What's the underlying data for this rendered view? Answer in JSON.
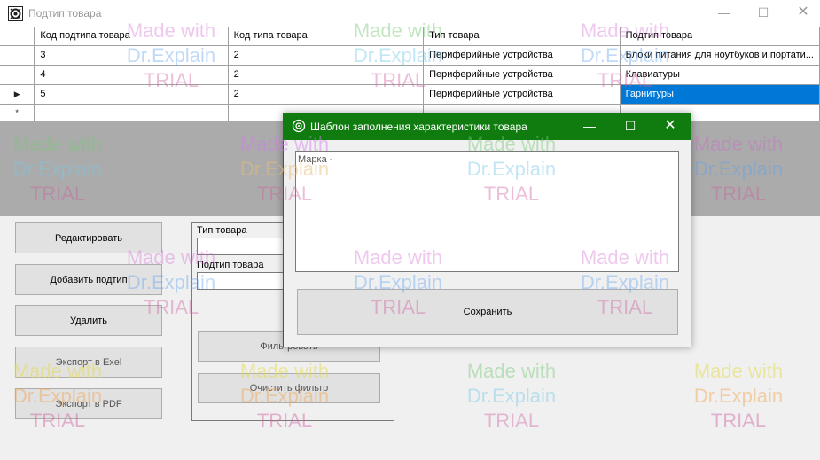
{
  "main_window": {
    "title": "Подтип товара",
    "minimize_glyph": "—",
    "maximize_glyph": "☐",
    "close_glyph": "✕"
  },
  "grid": {
    "columns": [
      "Код подтипа товара",
      "Код типа товара",
      "Тип товара",
      "Подтип товара"
    ],
    "rows": [
      [
        "3",
        "2",
        "Периферийные устройства",
        "Блоки питания для ноутбуков и портати..."
      ],
      [
        "4",
        "2",
        "Периферийные устройства",
        "Клавиатуры"
      ],
      [
        "5",
        "2",
        "Периферийные устройства",
        "Гарнитуры"
      ]
    ],
    "current_row_marker": "▶",
    "new_row_marker": "*",
    "selection_color": "#0078d7"
  },
  "buttons": {
    "edit": "Редактировать",
    "add": "Добавить подтип",
    "delete": "Удалить",
    "export_excel": "Экспорт в Exel",
    "export_pdf": "Экспорт в PDF"
  },
  "filter": {
    "type_label": "Тип товара",
    "subtype_label": "Подтип товара",
    "type_value": "",
    "subtype_value": "",
    "filter_button": "Фильтровать",
    "clear_button": "Очистить фильтр"
  },
  "dialog": {
    "title": "Шаблон заполнения характеристики товара",
    "field_placeholder": "Марка -",
    "save_button": "Сохранить",
    "title_bar_color": "#107c10",
    "minimize_glyph": "—",
    "maximize_glyph": "☐",
    "close_glyph": "✕"
  },
  "watermark": {
    "line1": "Made with",
    "line2": "Dr.Explain",
    "line3": "TRIAL"
  }
}
